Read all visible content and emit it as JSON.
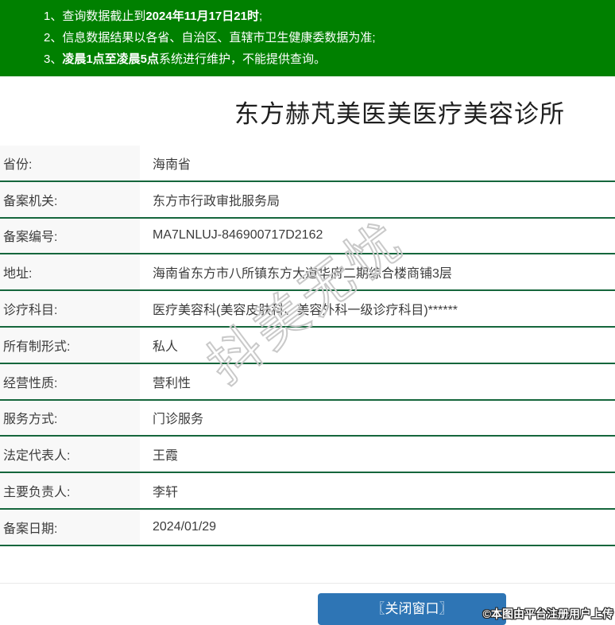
{
  "colors": {
    "header_green": "#008000",
    "table_border_green": "#15663c",
    "button_blue": "#2e75b5",
    "label_cell_bg": "#f8f8f8",
    "body_text": "#3c3c3c",
    "watermark_gray": "#c9c9c9"
  },
  "notices": [
    {
      "pre": "1、查询数据截止到",
      "bold": "2024年11月17日21时",
      "post": ";"
    },
    {
      "pre": "2、信息数据结果以各省、自治区、直辖市卫生健康委数据为准;",
      "bold": "",
      "post": ""
    },
    {
      "pre": "3、",
      "bold": "凌晨1点至凌晨5点",
      "post": "系统进行维护，不能提供查询。"
    }
  ],
  "title": "东方赫芃美医美医疗美容诊所",
  "record_table": {
    "rows": [
      {
        "label": "省份:",
        "value": "海南省"
      },
      {
        "label": "备案机关:",
        "value": "东方市行政审批服务局"
      },
      {
        "label": "备案编号:",
        "value": "MA7LNLUJ-846900717D2162"
      },
      {
        "label": "地址:",
        "value": "海南省东方市八所镇东方大道华府二期综合楼商铺3层"
      },
      {
        "label": "诊疗科目:",
        "value": "医疗美容科(美容皮肤科、美容外科一级诊疗科目)******"
      },
      {
        "label": "所有制形式:",
        "value": "私人"
      },
      {
        "label": "经营性质:",
        "value": "营利性"
      },
      {
        "label": "服务方式:",
        "value": "门诊服务"
      },
      {
        "label": "法定代表人:",
        "value": "王霞"
      },
      {
        "label": "主要负责人:",
        "value": "李轩"
      },
      {
        "label": "备案日期:",
        "value": "2024/01/29"
      }
    ]
  },
  "watermark": "抖美无忧",
  "footer": {
    "close_button_label": "〖关闭窗口〗",
    "credit": "©本图由平台注册用户上传"
  }
}
